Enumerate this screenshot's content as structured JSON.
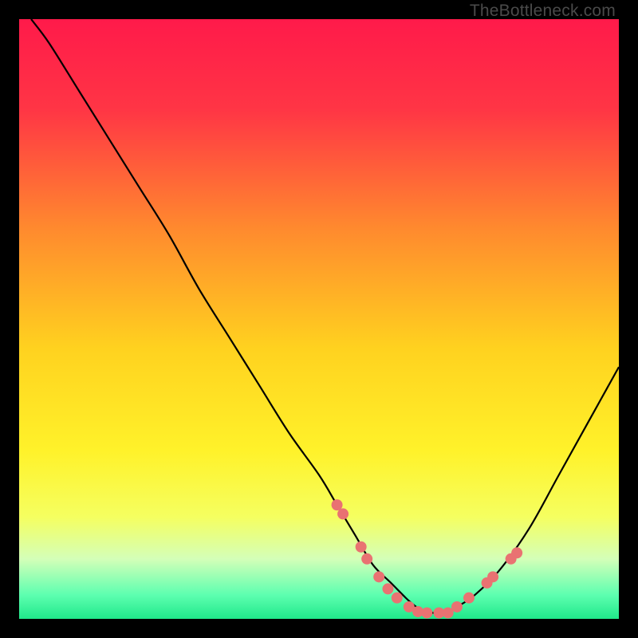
{
  "watermark": "TheBottleneck.com",
  "chart_data": {
    "type": "line",
    "title": "",
    "xlabel": "",
    "ylabel": "",
    "xlim": [
      0,
      100
    ],
    "ylim": [
      0,
      100
    ],
    "background_gradient": {
      "stops": [
        {
          "offset": 0.0,
          "color": "#ff1a4a"
        },
        {
          "offset": 0.15,
          "color": "#ff3545"
        },
        {
          "offset": 0.35,
          "color": "#ff8a2e"
        },
        {
          "offset": 0.55,
          "color": "#ffd21f"
        },
        {
          "offset": 0.72,
          "color": "#fff22a"
        },
        {
          "offset": 0.83,
          "color": "#f5ff60"
        },
        {
          "offset": 0.9,
          "color": "#d4ffb8"
        },
        {
          "offset": 0.96,
          "color": "#5dffb0"
        },
        {
          "offset": 1.0,
          "color": "#20e88a"
        }
      ]
    },
    "series": [
      {
        "name": "bottleneck-curve",
        "x": [
          2,
          5,
          10,
          15,
          20,
          25,
          30,
          35,
          40,
          45,
          50,
          53,
          56,
          59,
          62,
          65,
          67,
          69,
          71,
          73,
          76,
          80,
          85,
          90,
          95,
          100
        ],
        "y": [
          100,
          96,
          88,
          80,
          72,
          64,
          55,
          47,
          39,
          31,
          24,
          19,
          14,
          9,
          6,
          3,
          1.5,
          1,
          1,
          2,
          4,
          8,
          15,
          24,
          33,
          42
        ]
      }
    ],
    "markers": {
      "name": "dotted-segment",
      "color": "#e97272",
      "radius": 7,
      "points": [
        {
          "x": 53,
          "y": 19
        },
        {
          "x": 54,
          "y": 17.5
        },
        {
          "x": 57,
          "y": 12
        },
        {
          "x": 58,
          "y": 10
        },
        {
          "x": 60,
          "y": 7
        },
        {
          "x": 61.5,
          "y": 5
        },
        {
          "x": 63,
          "y": 3.5
        },
        {
          "x": 65,
          "y": 2
        },
        {
          "x": 66.5,
          "y": 1.2
        },
        {
          "x": 68,
          "y": 1
        },
        {
          "x": 70,
          "y": 1
        },
        {
          "x": 71.5,
          "y": 1
        },
        {
          "x": 73,
          "y": 2
        },
        {
          "x": 75,
          "y": 3.5
        },
        {
          "x": 78,
          "y": 6
        },
        {
          "x": 79,
          "y": 7
        },
        {
          "x": 82,
          "y": 10
        },
        {
          "x": 83,
          "y": 11
        }
      ]
    }
  }
}
